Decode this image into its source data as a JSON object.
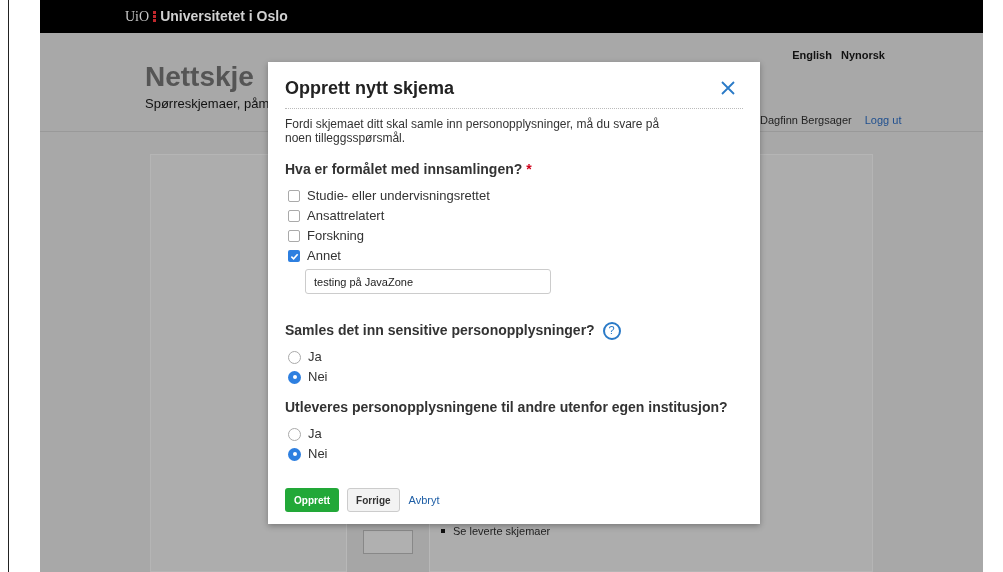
{
  "brand_bar": {
    "logo_mark": "UiO",
    "name": "Universitetet i Oslo"
  },
  "header": {
    "languages": [
      {
        "label": "English"
      },
      {
        "label": "Nynorsk"
      }
    ],
    "title": "Nettskje",
    "subtitle": "Spørreskjemaer, påm",
    "user": "Dagfinn Bergsager",
    "logout": "Logg ut"
  },
  "background_list": [
    "Se leverte skjemaer"
  ],
  "dialog": {
    "title": "Opprett nytt skjema",
    "intro": "Fordi skjemaet ditt skal samle inn personopplysninger, må du svare på noen tilleggsspørsmål.",
    "questions": [
      {
        "kind": "checkbox",
        "label": "Hva er formålet med innsamlingen?",
        "required_mark": "*",
        "options": [
          {
            "label": "Studie- eller undervisningsrettet",
            "checked": false
          },
          {
            "label": "Ansattrelatert",
            "checked": false
          },
          {
            "label": "Forskning",
            "checked": false
          },
          {
            "label": "Annet",
            "checked": true,
            "value": "testing på JavaZone"
          }
        ]
      },
      {
        "kind": "radio",
        "label": "Samles det inn sensitive personopplysninger?",
        "help_icon": "?",
        "options": [
          {
            "label": "Ja",
            "selected": false
          },
          {
            "label": "Nei",
            "selected": true
          }
        ]
      },
      {
        "kind": "radio",
        "label": "Utleveres personopplysningene til andre utenfor egen institusjon?",
        "options": [
          {
            "label": "Ja",
            "selected": false
          },
          {
            "label": "Nei",
            "selected": true
          }
        ]
      }
    ],
    "buttons": [
      {
        "label": "Opprett",
        "kind": "primary"
      },
      {
        "label": "Forrige",
        "kind": "secondary"
      },
      {
        "label": "Avbryt",
        "kind": "link"
      }
    ]
  }
}
